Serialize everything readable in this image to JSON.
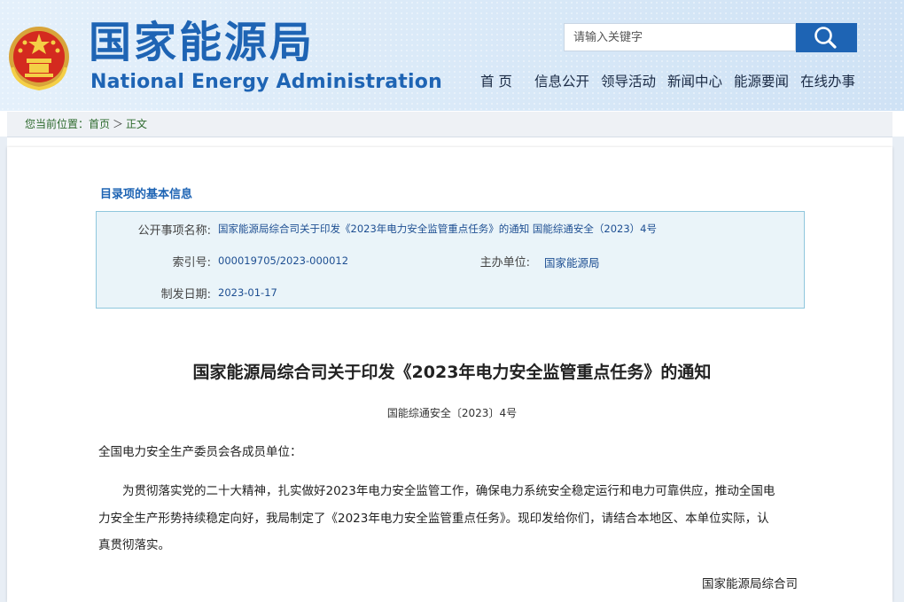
{
  "header": {
    "title_cn": "国家能源局",
    "title_en": "National Energy Administration",
    "emblem_icon": "national-emblem-icon",
    "accent_color": "#1e64b4"
  },
  "search": {
    "placeholder": "请输入关键字",
    "button_icon": "search-icon"
  },
  "nav": {
    "items": [
      "首 页",
      "信息公开",
      "领导活动",
      "新闻中心",
      "能源要闻",
      "在线办事"
    ]
  },
  "breadcrumb": {
    "label": "您当前位置：",
    "home": "首页",
    "sep": "＞",
    "current": "正文"
  },
  "info": {
    "section_title": "目录项的基本信息",
    "fields": {
      "item_name_label": "公开事项名称:",
      "item_name_value": "国家能源局综合司关于印发《2023年电力安全监管重点任务》的通知 国能综通安全（2023）4号",
      "index_label": "索引号:",
      "index_value": "000019705/2023-000012",
      "host_label": "主办单位:",
      "host_value": "国家能源局",
      "date_label": "制发日期:",
      "date_value": "2023-01-17"
    }
  },
  "document": {
    "title": "国家能源局综合司关于印发《2023年电力安全监管重点任务》的通知",
    "doc_number": "国能综通安全〔2023〕4号",
    "recipient": "全国电力安全生产委员会各成员单位：",
    "body_line1": "为贯彻落实党的二十大精神，扎实做好2023年电力安全监管工作，确保电力系统安全稳定运行和电力可靠供应，推动全国电",
    "body_line2": "力安全生产形势持续稳定向好，我局制定了《2023年电力安全监管重点任务》。现印发给你们，请结合本地区、本单位实际，认",
    "body_line3": "真贯彻落实。",
    "signature": "国家能源局综合司"
  }
}
